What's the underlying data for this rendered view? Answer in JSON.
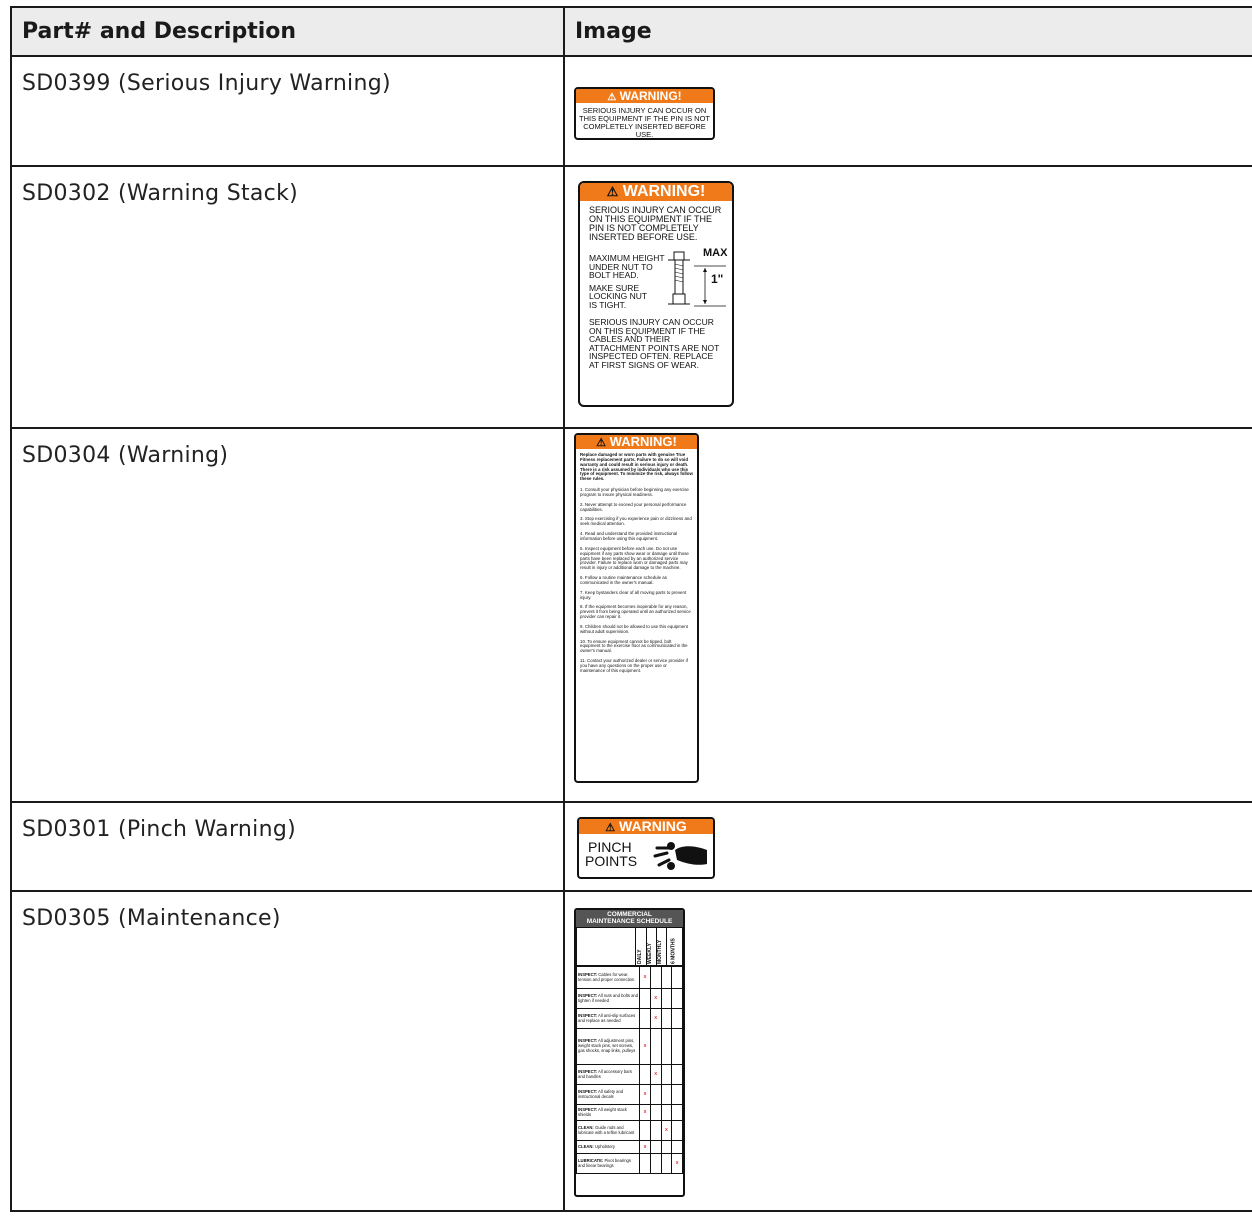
{
  "table": {
    "headers": [
      "Part# and Description",
      "Image"
    ],
    "rows": [
      {
        "description": "SD0399 (Serious Injury Warning)"
      },
      {
        "description": "SD0302 (Warning Stack)"
      },
      {
        "description": "SD0304 (Warning)"
      },
      {
        "description": "SD0301 (Pinch Warning)"
      },
      {
        "description": "SD0305 (Maintenance)"
      }
    ]
  },
  "decals": {
    "sd0399": {
      "header": "WARNING!",
      "lines": [
        "SERIOUS INJURY CAN OCCUR ON",
        "THIS EQUIPMENT IF THE PIN IS NOT",
        "COMPLETELY INSERTED BEFORE USE."
      ]
    },
    "sd0302": {
      "header": "WARNING!",
      "para1": [
        "SERIOUS INJURY CAN OCCUR",
        "ON THIS EQUIPMENT IF THE",
        "PIN IS NOT COMPLETELY",
        "INSERTED BEFORE USE."
      ],
      "para2": [
        "MAXIMUM HEIGHT",
        "UNDER NUT TO",
        "BOLT HEAD."
      ],
      "para3": [
        "MAKE SURE",
        "LOCKING NUT",
        "IS TIGHT."
      ],
      "max_label": "MAX",
      "max_value": "1\"",
      "para4": [
        "SERIOUS INJURY CAN OCCUR",
        "ON THIS EQUIPMENT IF THE",
        "CABLES AND THEIR",
        "ATTACHMENT POINTS ARE NOT",
        "INSPECTED OFTEN. REPLACE",
        "AT FIRST SIGNS OF WEAR."
      ]
    },
    "sd0304": {
      "header": "WARNING!",
      "intro": "Replace damaged or worn parts with genuine True Fitness replacement parts. Failure to do so will void warranty and could result in serious injury or death. There is a risk assumed by individuals who use this type of equipment. To minimize the risk, always follow these rules.",
      "rules": [
        "1. Consult your physician before beginning any exercise program to insure physical readiness.",
        "2. Never attempt to exceed your personal performance capabilities.",
        "3. Stop exercising if you experience pain or dizziness and seek medical attention.",
        "4. Read and understand the provided instructional information before using this equipment.",
        "5. Inspect equipment before each use. Do not use equipment if any parts show wear or damage until those parts have been replaced by an authorized service provider. Failure to replace worn or damaged parts may result in injury or additional damage to the machine.",
        "6. Follow a routine maintenance schedule as communicated in the owner's manual.",
        "7. Keep bystanders clear of all moving parts to prevent injury.",
        "8. If the equipment becomes inoperable for any reason, prevent it from being operated until an authorized service provider can repair it.",
        "9. Children should not be allowed to use this equipment without adult supervision.",
        "10. To ensure equipment cannot be tipped, bolt equipment to the exercise floor as communicated in the owner's manual.",
        "11. Contact your authorized dealer or service provider if you have any questions on the proper use or maintenance of this equipment."
      ]
    },
    "sd0301": {
      "header": "WARNING",
      "lines": [
        "PINCH",
        "POINTS"
      ]
    },
    "sd0305": {
      "title": [
        "COMMERCIAL",
        "MAINTENANCE SCHEDULE"
      ],
      "columns": [
        "DAILY",
        "WEEKLY",
        "MONTHLY",
        "6 MONTHS"
      ],
      "rows": [
        {
          "label": "INSPECT:",
          "text": " Cables for wear, tension and proper connection",
          "x": 0
        },
        {
          "label": "INSPECT:",
          "text": " All nuts and bolts and tighten if needed",
          "x": 1
        },
        {
          "label": "INSPECT:",
          "text": " All anti-slip surfaces and replace as needed",
          "x": 1
        },
        {
          "label": "INSPECT:",
          "text": " All adjustment pins, weight stack pins, set screws, gas shocks, snap links, pulleys",
          "x": 0
        },
        {
          "label": "INSPECT:",
          "text": " All accessory bars and handles",
          "x": 1
        },
        {
          "label": "INSPECT:",
          "text": " All safety and instructional decals",
          "x": 0
        },
        {
          "label": "INSPECT:",
          "text": " All weight stack shields",
          "x": 0
        },
        {
          "label": "CLEAN:",
          "text": " Guide rods and lubricate with a teflon lubricant",
          "x": 2
        },
        {
          "label": "CLEAN:",
          "text": " Upholstery",
          "x": 0
        },
        {
          "label": "LUBRICATE:",
          "text": " Pivot bearings and linear bearings",
          "x": 3
        }
      ],
      "mark": "X"
    }
  },
  "colors": {
    "warning_orange": "#f07a1a",
    "x_red": "#e21a1a",
    "header_bg": "#ececec"
  }
}
